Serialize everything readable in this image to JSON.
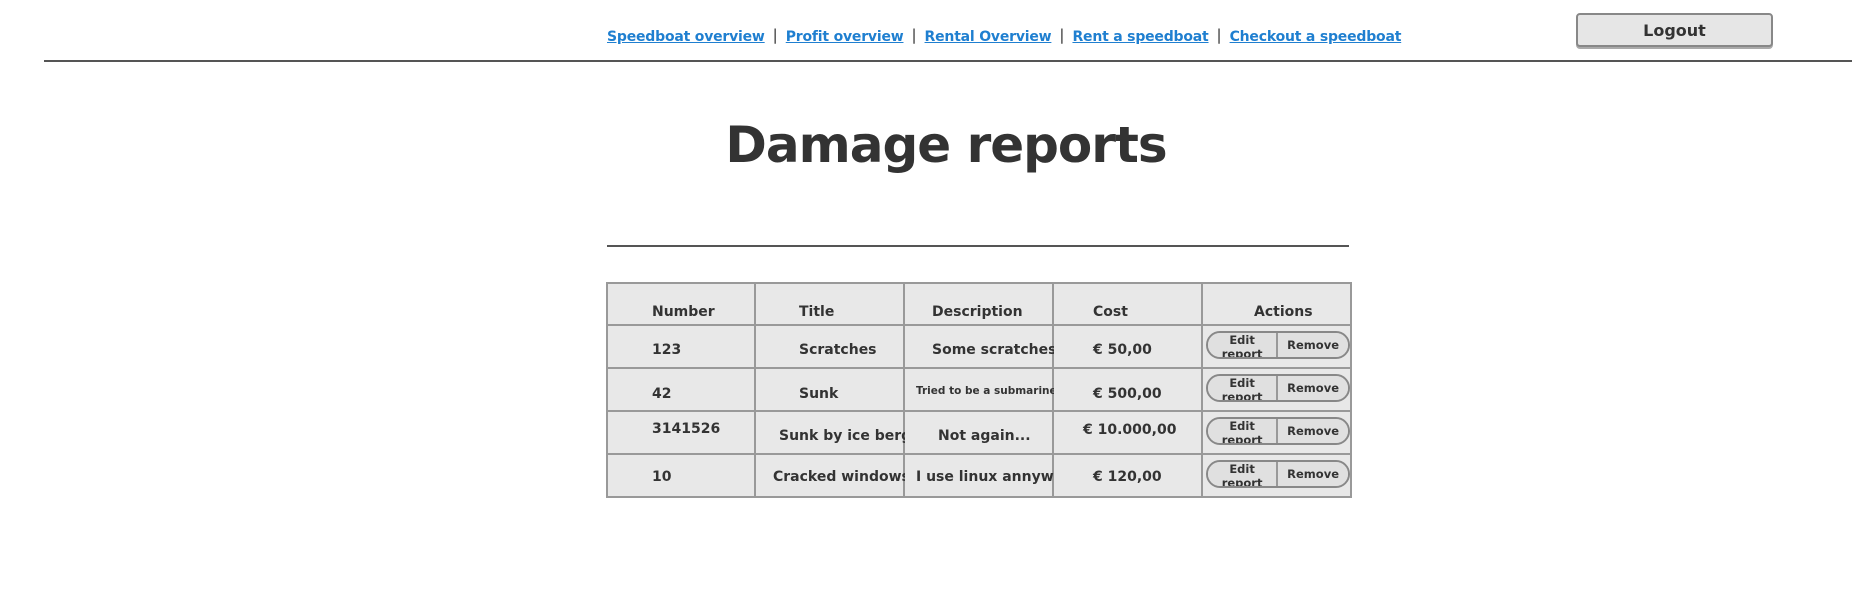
{
  "nav": {
    "links": [
      "Speedboat overview",
      "Profit overview",
      "Rental Overview",
      "Rent a speedboat",
      "Checkout a speedboat"
    ],
    "separator": "|"
  },
  "logout_label": "Logout",
  "page_title": "Damage reports",
  "table": {
    "columns": [
      "Number",
      "Title",
      "Description",
      "Cost",
      "Actions"
    ],
    "rows": [
      {
        "number": "123",
        "title": "Scratches",
        "description": "Some scratches",
        "cost": "€ 50,00"
      },
      {
        "number": "42",
        "title": "Sunk",
        "description": "Tried to be a submarine",
        "cost": "€ 500,00"
      },
      {
        "number": "3141526",
        "title": "Sunk by ice berg",
        "description": "Not again...",
        "cost": "€ 10.000,00"
      },
      {
        "number": "10",
        "title": "Cracked windows",
        "description": "I use linux annyway",
        "cost": "€ 120,00"
      }
    ],
    "actions": {
      "edit_label": "Edit report",
      "remove_label": "Remove"
    }
  }
}
